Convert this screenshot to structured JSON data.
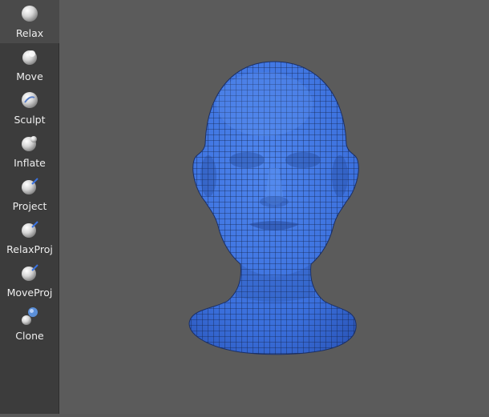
{
  "toolbar": {
    "tools": [
      {
        "label": "Relax",
        "icon": "sphere-icon",
        "active": true
      },
      {
        "label": "Move",
        "icon": "sphere-move-icon",
        "active": false
      },
      {
        "label": "Sculpt",
        "icon": "sphere-sculpt-icon",
        "active": false
      },
      {
        "label": "Inflate",
        "icon": "sphere-inflate-icon",
        "active": false
      },
      {
        "label": "Project",
        "icon": "sphere-project-icon",
        "active": false
      },
      {
        "label": "RelaxProj",
        "icon": "sphere-relaxproj-icon",
        "active": false
      },
      {
        "label": "MoveProj",
        "icon": "sphere-moveproj-icon",
        "active": false
      },
      {
        "label": "Clone",
        "icon": "sphere-clone-icon",
        "active": false
      }
    ]
  },
  "viewport": {
    "mesh": "head-mesh",
    "mesh_color": "#3a6fdc",
    "wire_color": "#15244a"
  }
}
